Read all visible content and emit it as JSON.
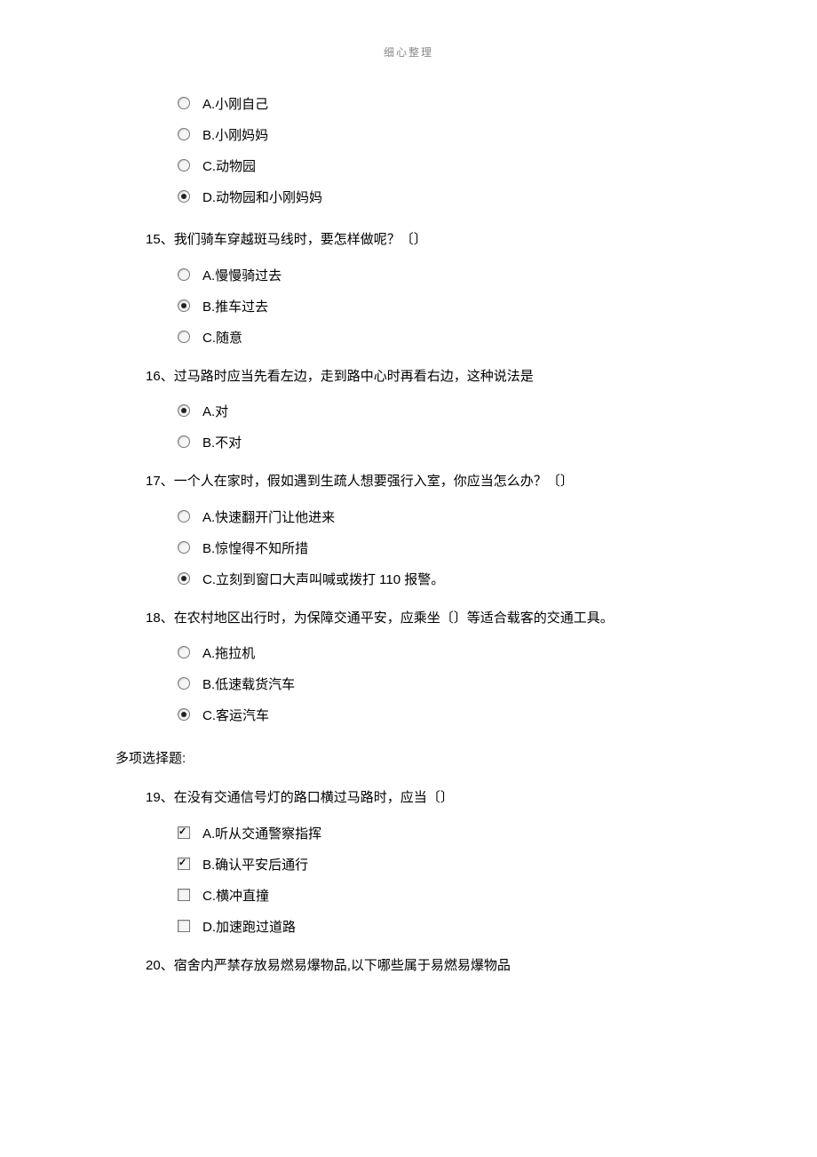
{
  "header": "细心整理",
  "orphan_q14_options": [
    {
      "label": "A.小刚自己",
      "selected": false
    },
    {
      "label": "B.小刚妈妈",
      "selected": false
    },
    {
      "label": "C.动物园",
      "selected": false
    },
    {
      "label": "D.动物园和小刚妈妈",
      "selected": true
    }
  ],
  "questions": [
    {
      "number": "15、",
      "text": "我们骑车穿越斑马线时，要怎样做呢？〔〕",
      "type": "radio",
      "options": [
        {
          "label": "A.慢慢骑过去",
          "selected": false
        },
        {
          "label": "B.推车过去",
          "selected": true
        },
        {
          "label": "C.随意",
          "selected": false
        }
      ]
    },
    {
      "number": "16、",
      "text": "过马路时应当先看左边，走到路中心时再看右边，这种说法是",
      "type": "radio",
      "options": [
        {
          "label": "A.对",
          "selected": true
        },
        {
          "label": "B.不对",
          "selected": false
        }
      ]
    },
    {
      "number": "17、",
      "text": "一个人在家时，假如遇到生疏人想要强行入室，你应当怎么办？〔〕",
      "type": "radio",
      "options": [
        {
          "label": "A.快速翻开门让他进来",
          "selected": false
        },
        {
          "label": "B.惊惶得不知所措",
          "selected": false
        },
        {
          "label": "C.立刻到窗口大声叫喊或拨打 110 报警。",
          "selected": true
        }
      ]
    },
    {
      "number": "18、",
      "text": "在农村地区出行时，为保障交通平安，应乘坐〔〕等适合载客的交通工具。",
      "type": "radio",
      "options": [
        {
          "label": "A.拖拉机",
          "selected": false
        },
        {
          "label": "B.低速载货汽车",
          "selected": false
        },
        {
          "label": "C.客运汽车",
          "selected": true
        }
      ]
    }
  ],
  "section_heading": "多项选择题:",
  "multi_questions": [
    {
      "number": "19、",
      "text": "在没有交通信号灯的路口横过马路时，应当〔〕",
      "type": "checkbox",
      "options": [
        {
          "label": "A.听从交通警察指挥",
          "selected": true
        },
        {
          "label": "B.确认平安后通行",
          "selected": true
        },
        {
          "label": "C.横冲直撞",
          "selected": false
        },
        {
          "label": "D.加速跑过道路",
          "selected": false
        }
      ]
    },
    {
      "number": "20、",
      "text": "宿舍内严禁存放易燃易爆物品,以下哪些属于易燃易爆物品",
      "type": "checkbox",
      "options": []
    }
  ]
}
